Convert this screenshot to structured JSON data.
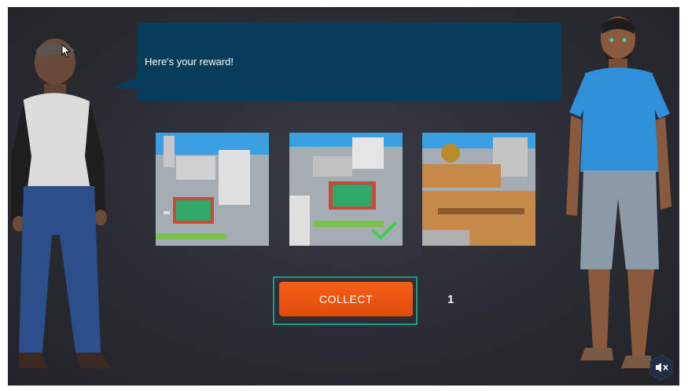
{
  "dialog": {
    "message": "Here's your reward!"
  },
  "rewards": [
    {
      "name": "basketball-court-city"
    },
    {
      "name": "basketball-court-city",
      "selected": true
    },
    {
      "name": "wooden-plaza-city"
    }
  ],
  "actions": {
    "collect_label": "COLLECT"
  },
  "counter": {
    "value": "1"
  },
  "icons": {
    "mute": "speaker-muted-icon",
    "check": "checkmark-icon"
  },
  "colors": {
    "accent": "#f15a17",
    "dialog": "#073c5a",
    "frame": "#1b9e86",
    "check": "#3ccf4e"
  }
}
